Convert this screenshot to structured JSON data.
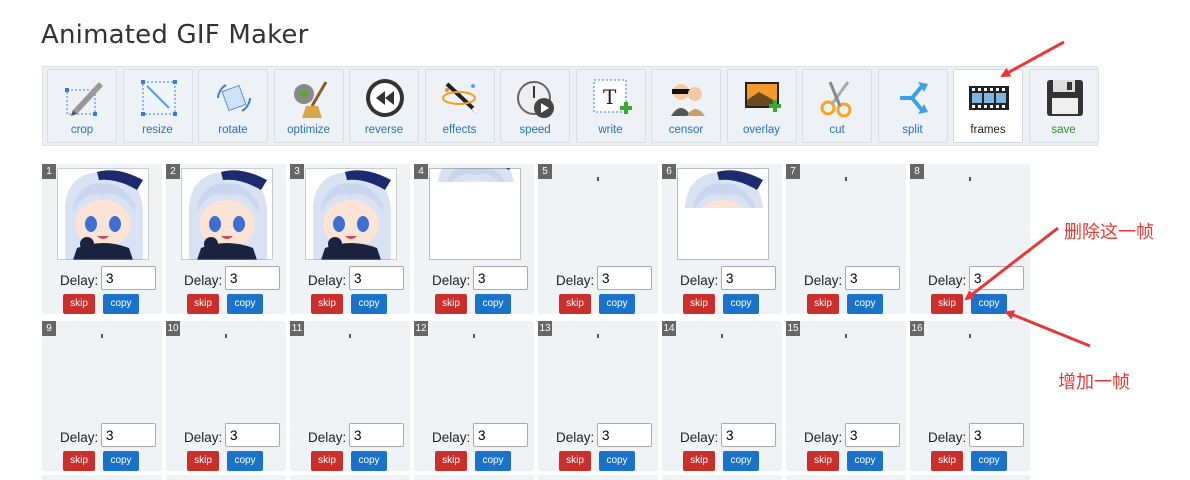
{
  "title": "Animated GIF Maker",
  "toolbar": [
    {
      "label": "crop",
      "icon": "crop-icon"
    },
    {
      "label": "resize",
      "icon": "resize-icon"
    },
    {
      "label": "rotate",
      "icon": "rotate-icon"
    },
    {
      "label": "optimize",
      "icon": "optimize-icon"
    },
    {
      "label": "reverse",
      "icon": "reverse-icon"
    },
    {
      "label": "effects",
      "icon": "effects-icon"
    },
    {
      "label": "speed",
      "icon": "speed-icon"
    },
    {
      "label": "write",
      "icon": "write-icon"
    },
    {
      "label": "censor",
      "icon": "censor-icon"
    },
    {
      "label": "overlay",
      "icon": "overlay-icon"
    },
    {
      "label": "cut",
      "icon": "cut-icon"
    },
    {
      "label": "split",
      "icon": "split-icon"
    },
    {
      "label": "frames",
      "icon": "frames-icon",
      "active": true
    },
    {
      "label": "save",
      "icon": "save-icon"
    }
  ],
  "frames": [
    {
      "num": "1",
      "delay": "3",
      "thumb": "full"
    },
    {
      "num": "2",
      "delay": "3",
      "thumb": "full"
    },
    {
      "num": "3",
      "delay": "3",
      "thumb": "full"
    },
    {
      "num": "4",
      "delay": "3",
      "thumb": "partial-top"
    },
    {
      "num": "5",
      "delay": "3",
      "thumb": "blank"
    },
    {
      "num": "6",
      "delay": "3",
      "thumb": "partial-corner"
    },
    {
      "num": "7",
      "delay": "3",
      "thumb": "blank"
    },
    {
      "num": "8",
      "delay": "3",
      "thumb": "blank"
    },
    {
      "num": "9",
      "delay": "3",
      "thumb": "blank"
    },
    {
      "num": "10",
      "delay": "3",
      "thumb": "blank"
    },
    {
      "num": "11",
      "delay": "3",
      "thumb": "blank"
    },
    {
      "num": "12",
      "delay": "3",
      "thumb": "blank"
    },
    {
      "num": "13",
      "delay": "3",
      "thumb": "blank"
    },
    {
      "num": "14",
      "delay": "3",
      "thumb": "blank"
    },
    {
      "num": "15",
      "delay": "3",
      "thumb": "blank"
    },
    {
      "num": "16",
      "delay": "3",
      "thumb": "blank"
    }
  ],
  "labels": {
    "delay": "Delay:",
    "skip": "skip",
    "copy": "copy"
  },
  "annotations": {
    "delete_frame": "删除这一帧",
    "add_frame": "增加一帧"
  },
  "colors": {
    "skip": "#c9302c",
    "copy": "#1a73c9",
    "annotation": "#e53935"
  }
}
